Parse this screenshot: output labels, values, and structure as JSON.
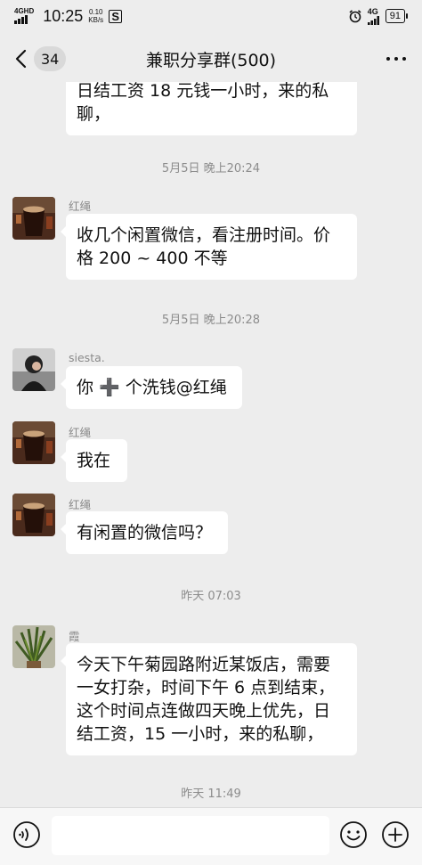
{
  "status_bar": {
    "network_tag": "4GHD",
    "time": "10:25",
    "speed_value": "0.10",
    "speed_unit": "KB/s",
    "app_icon_letter": "S",
    "net_right": "4G",
    "battery": "91"
  },
  "header": {
    "unread_count": "34",
    "title": "兼职分享群(500)"
  },
  "messages": [
    {
      "type": "bubble",
      "text": "日结工资 18 元钱一小时，来的私\n聊，",
      "cut": true
    },
    {
      "type": "time",
      "text": "5月5日 晚上20:24"
    },
    {
      "type": "msg",
      "sender": "红绳",
      "avatar": "coffee",
      "text": "收几个闲置微信，看注册时间。价\n格 200 ~ 400 不等"
    },
    {
      "type": "time",
      "text": "5月5日 晚上20:28"
    },
    {
      "type": "msg",
      "sender": "siesta.",
      "avatar": "portrait",
      "text": "你 ➕ 个洗钱@红绳"
    },
    {
      "type": "msg",
      "sender": "红绳",
      "avatar": "coffee",
      "text": "我在"
    },
    {
      "type": "msg",
      "sender": "红绳",
      "avatar": "coffee",
      "text": "有闲置的微信吗？"
    },
    {
      "type": "time",
      "text": "昨天 07:03"
    },
    {
      "type": "msg",
      "sender": "霞",
      "avatar": "plant",
      "text": "今天下午菊园路附近某饭店，需要\n一女打杂，时间下午 6 点到结束，\n这个时间点连做四天晚上优先，日\n结工资，15 一小时，来的私聊，"
    },
    {
      "type": "time",
      "text": "昨天 11:49"
    }
  ],
  "input": {
    "placeholder": ""
  },
  "icons": {
    "back": "back-arrow-icon",
    "more": "more-dots-icon",
    "voice": "voice-icon",
    "emoji": "emoji-icon",
    "plus": "plus-icon",
    "alarm": "alarm-icon"
  }
}
